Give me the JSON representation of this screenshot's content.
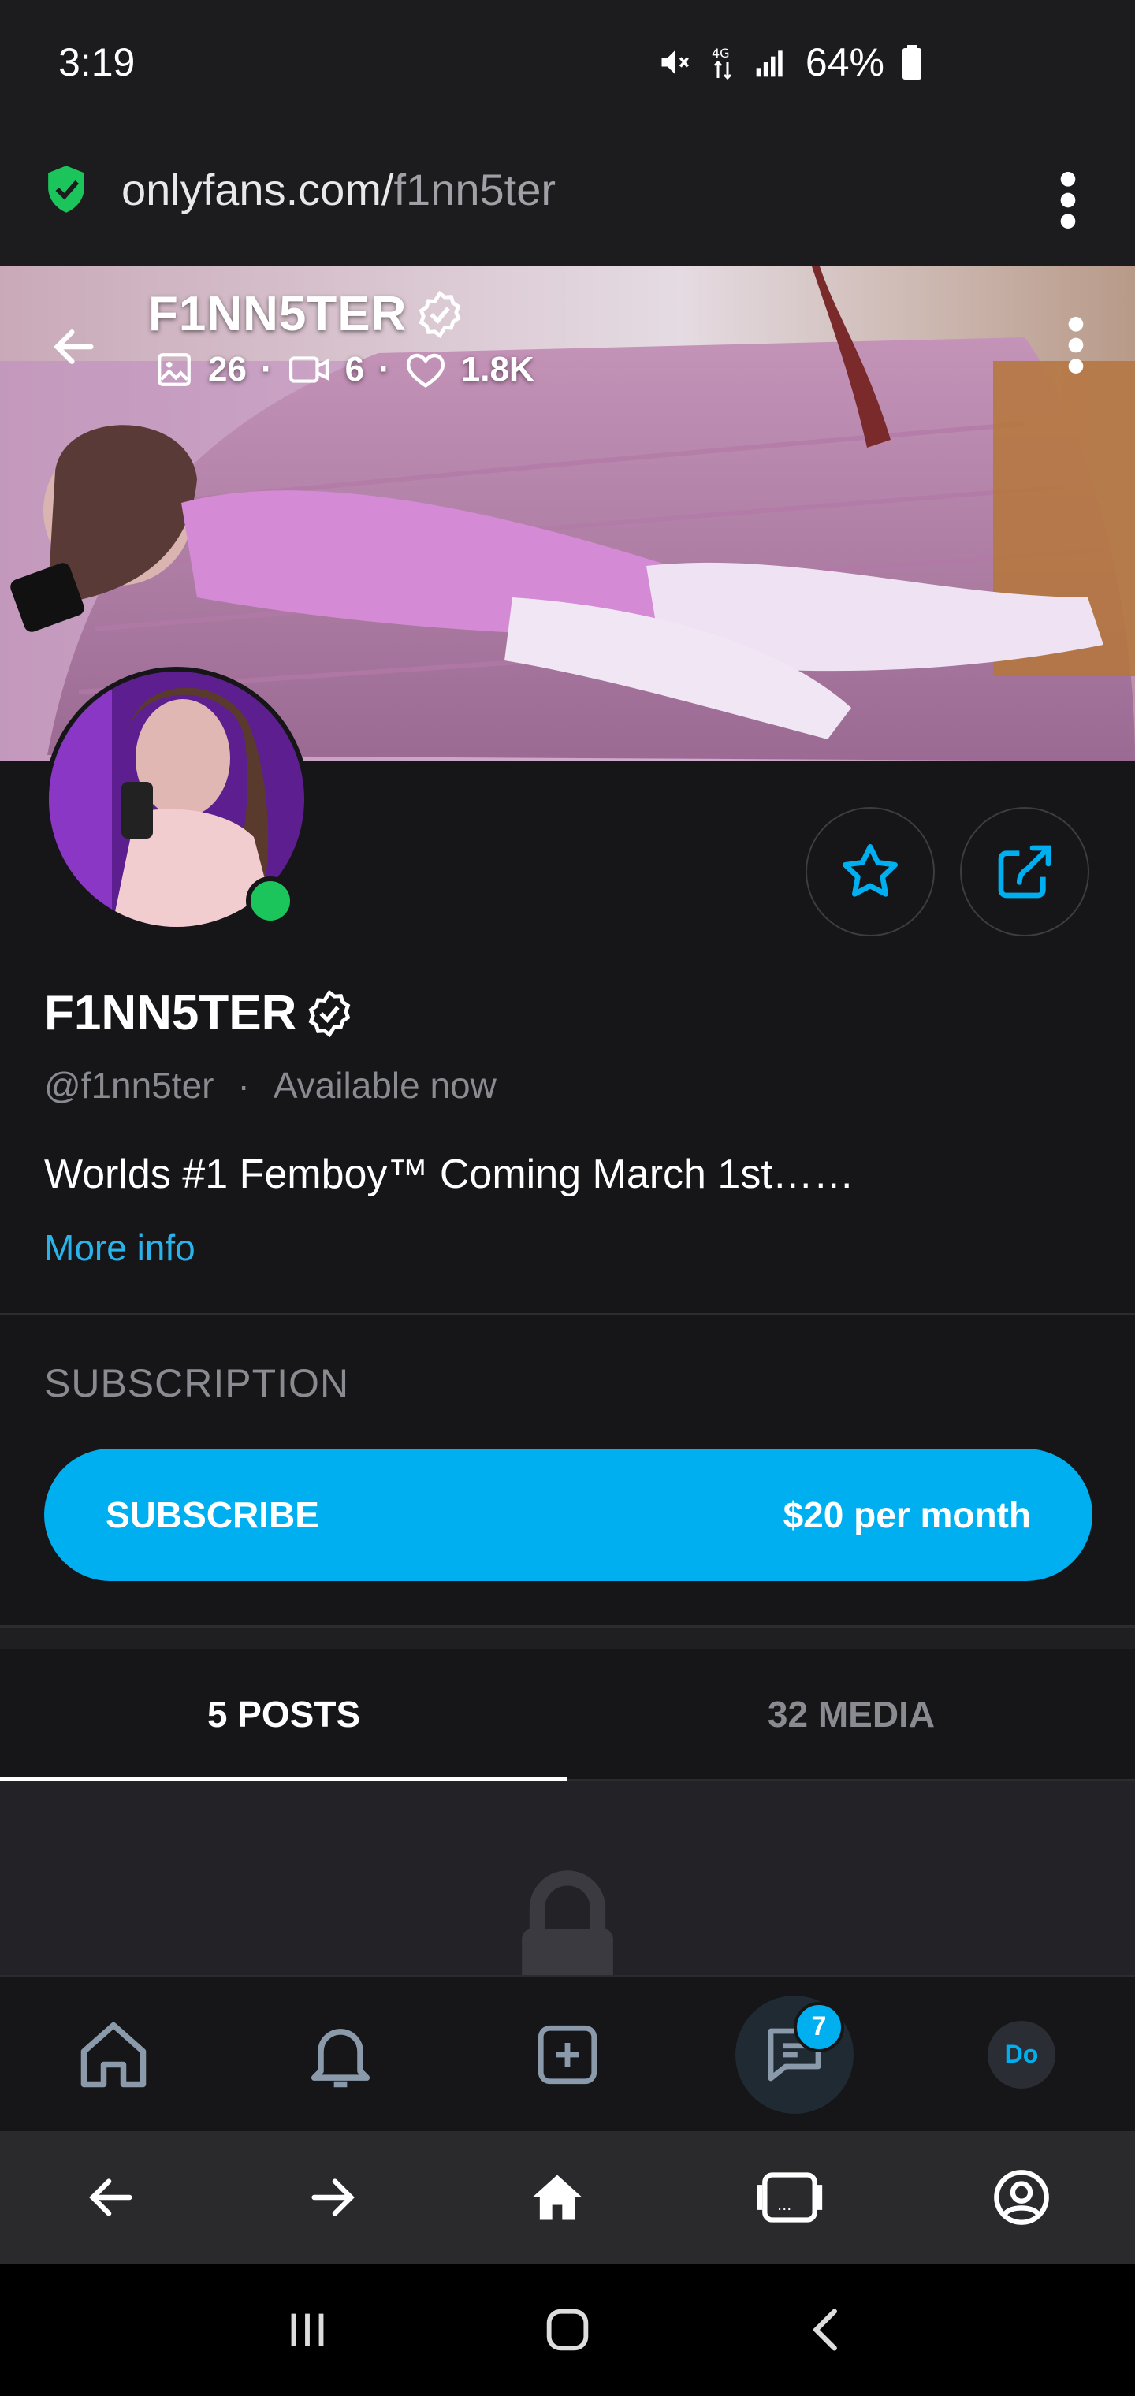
{
  "status_bar": {
    "time": "3:19",
    "battery": "64%"
  },
  "url_bar": {
    "host": "onlyfans.com/",
    "path": "f1nn5ter"
  },
  "cover": {
    "name": "F1NN5TER",
    "photos_count": "26",
    "videos_count": "6",
    "likes_count": "1.8K"
  },
  "profile": {
    "name": "F1NN5TER",
    "handle": "@f1nn5ter",
    "availability": "Available now",
    "bio": "Worlds #1 Femboy™ Coming March 1st……",
    "more_info": "More info"
  },
  "subscription": {
    "title": "SUBSCRIPTION",
    "button_label": "SUBSCRIBE",
    "price": "$20 per month"
  },
  "tabs": [
    {
      "label": "5 POSTS"
    },
    {
      "label": "32 MEDIA"
    }
  ],
  "app_nav": {
    "messages_badge": "7",
    "avatar_initials": "Do"
  },
  "colors": {
    "accent": "#00aff0",
    "background": "#161618",
    "online": "#1bc55b"
  }
}
